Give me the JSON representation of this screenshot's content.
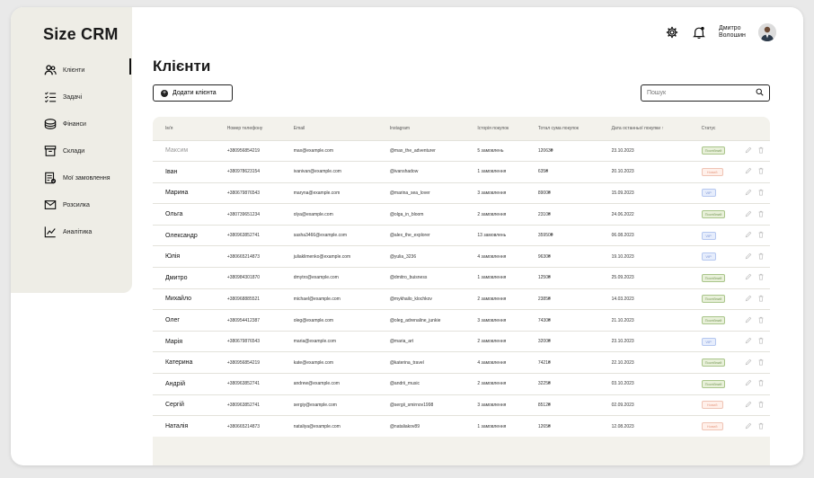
{
  "app": {
    "title": "Size CRM"
  },
  "sidebar": {
    "items": [
      {
        "label": "Клієнти",
        "icon": "users-icon"
      },
      {
        "label": "Задачі",
        "icon": "checklist-icon"
      },
      {
        "label": "Фінанси",
        "icon": "coins-icon"
      },
      {
        "label": "Склади",
        "icon": "warehouse-icon"
      },
      {
        "label": "Мої замовлення",
        "icon": "orders-icon"
      },
      {
        "label": "Розсилка",
        "icon": "mail-icon"
      },
      {
        "label": "Аналітика",
        "icon": "analytics-icon"
      }
    ]
  },
  "header": {
    "user_first": "Дмитро",
    "user_last": "Волошин"
  },
  "main": {
    "title": "Клієнти",
    "add_button": "Додати клієнта",
    "search_placeholder": "Пошук"
  },
  "table": {
    "columns": [
      "Ім'я",
      "Номер телефону",
      "Email",
      "Instagram",
      "Історія покупок",
      "Тотал сума покупок",
      "Дата останньої покупки ↑",
      "Статус"
    ],
    "rows": [
      {
        "name": "Максим",
        "phone": "+380956854219",
        "email": "max@example.com",
        "instagram": "@max_the_adventurer",
        "history": "5 замовлень",
        "total": "12063₴",
        "date": "23.10.2023",
        "status": "Постійний",
        "kind": "regular",
        "muted": true
      },
      {
        "name": "Іван",
        "phone": "+380978623154",
        "email": "ivanivan@example.com",
        "instagram": "@ivanshadow",
        "history": "1 замовлення",
        "total": "635₴",
        "date": "20.10.2023",
        "status": "Новий",
        "kind": "new"
      },
      {
        "name": "Марина",
        "phone": "+380679876543",
        "email": "maryna@example.com",
        "instagram": "@marina_sea_lover",
        "history": "3 замовлення",
        "total": "8900₴",
        "date": "15.09.2023",
        "status": "VIP",
        "kind": "vip"
      },
      {
        "name": "Ольга",
        "phone": "+380739651234",
        "email": "olya@example.com",
        "instagram": "@olga_in_bloom",
        "history": "2 замовлення",
        "total": "2310₴",
        "date": "24.06.2022",
        "status": "Постійний",
        "kind": "regular"
      },
      {
        "name": "Олександр",
        "phone": "+380963852741",
        "email": "sasha3466@example.com",
        "instagram": "@alex_the_explorer",
        "history": "13 замовлень",
        "total": "35950₴",
        "date": "06.08.2023",
        "status": "VIP",
        "kind": "vip"
      },
      {
        "name": "Юлія",
        "phone": "+380665214873",
        "email": "juliaklimenko@example.com",
        "instagram": "@yulia_3236",
        "history": "4 замовлення",
        "total": "9630₴",
        "date": "19.10.2023",
        "status": "VIP",
        "kind": "vip"
      },
      {
        "name": "Дмитро",
        "phone": "+380984301870",
        "email": "dmytro@example.com",
        "instagram": "@dmitro_buisness",
        "history": "1 замовлення",
        "total": "1250₴",
        "date": "25.09.2023",
        "status": "Постійний",
        "kind": "regular"
      },
      {
        "name": "Михайло",
        "phone": "+380968885521",
        "email": "michael@example.com",
        "instagram": "@mykhailo_klochkov",
        "history": "2 замовлення",
        "total": "2385₴",
        "date": "14.03.2023",
        "status": "Постійний",
        "kind": "regular"
      },
      {
        "name": "Олег",
        "phone": "+380954412387",
        "email": "oleg@example.com",
        "instagram": "@oleg_adrenaline_junkie",
        "history": "3 замовлення",
        "total": "7430₴",
        "date": "21.10.2023",
        "status": "Постійний",
        "kind": "regular"
      },
      {
        "name": "Марія",
        "phone": "+380679876543",
        "email": "maria@example.com",
        "instagram": "@maria_art",
        "history": "2 замовлення",
        "total": "3200₴",
        "date": "23.10.2023",
        "status": "VIP",
        "kind": "vip"
      },
      {
        "name": "Катерина",
        "phone": "+380956854219",
        "email": "kate@example.com",
        "instagram": "@katerina_travel",
        "history": "4 замовлення",
        "total": "7421₴",
        "date": "22.10.2023",
        "status": "Постійний",
        "kind": "regular"
      },
      {
        "name": "Андрій",
        "phone": "+380963852741",
        "email": "andrew@example.com",
        "instagram": "@andrii_music",
        "history": "2 замовлення",
        "total": "3225₴",
        "date": "03.10.2023",
        "status": "Постійний",
        "kind": "regular"
      },
      {
        "name": "Сергій",
        "phone": "+380963852741",
        "email": "sergiy@example.com",
        "instagram": "@sergii_smirnov1998",
        "history": "3 замовлення",
        "total": "8512₴",
        "date": "02.09.2023",
        "status": "Новий",
        "kind": "new"
      },
      {
        "name": "Наталія",
        "phone": "+380665214873",
        "email": "nataliya@example.com",
        "instagram": "@nataliakov89",
        "history": "1 замовлення",
        "total": "1265₴",
        "date": "12.08.2023",
        "status": "Новий",
        "kind": "new"
      }
    ]
  }
}
